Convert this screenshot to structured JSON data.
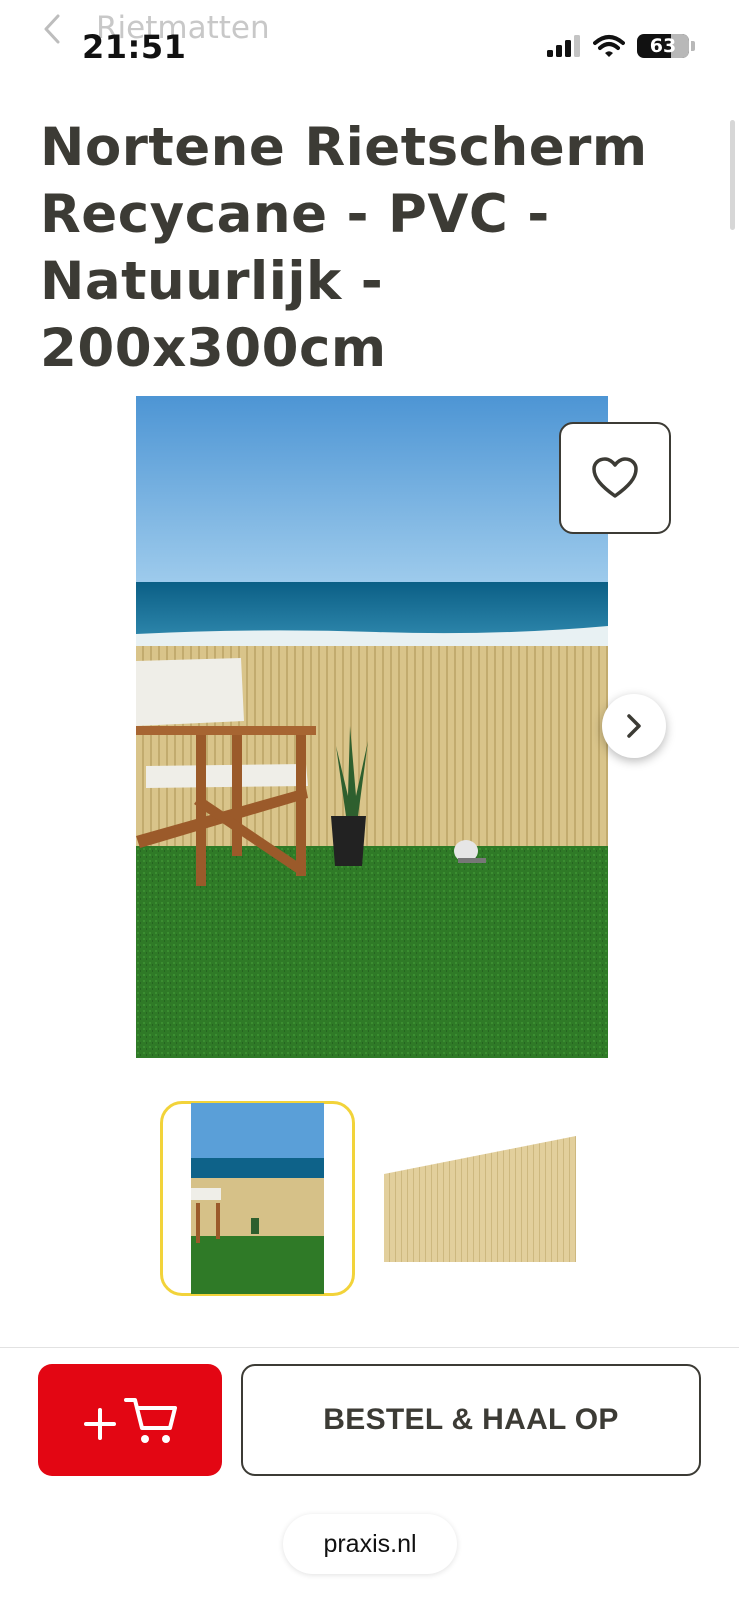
{
  "status_bar": {
    "time": "21:51",
    "battery": "63",
    "icons": [
      "signal-icon",
      "wifi-icon",
      "battery-icon"
    ]
  },
  "nav": {
    "back_icon": "chevron-left-icon",
    "breadcrumb": "Rietmatten"
  },
  "product": {
    "title": "Nortene Rietscherm Recycane - PVC - Natuurlijk - 200x300cm",
    "favorite_icon": "heart-icon",
    "next_icon": "chevron-right-icon",
    "thumbnails_selected_index": 0
  },
  "actions": {
    "add_to_cart_icons": [
      "plus-icon",
      "cart-icon"
    ],
    "order_pickup_label": "BESTEL & HAAL OP"
  },
  "browser": {
    "url": "praxis.nl"
  },
  "colors": {
    "brand_red": "#e30613",
    "text_dark": "#3c3b35",
    "thumb_selected_border": "#f2d33a"
  }
}
